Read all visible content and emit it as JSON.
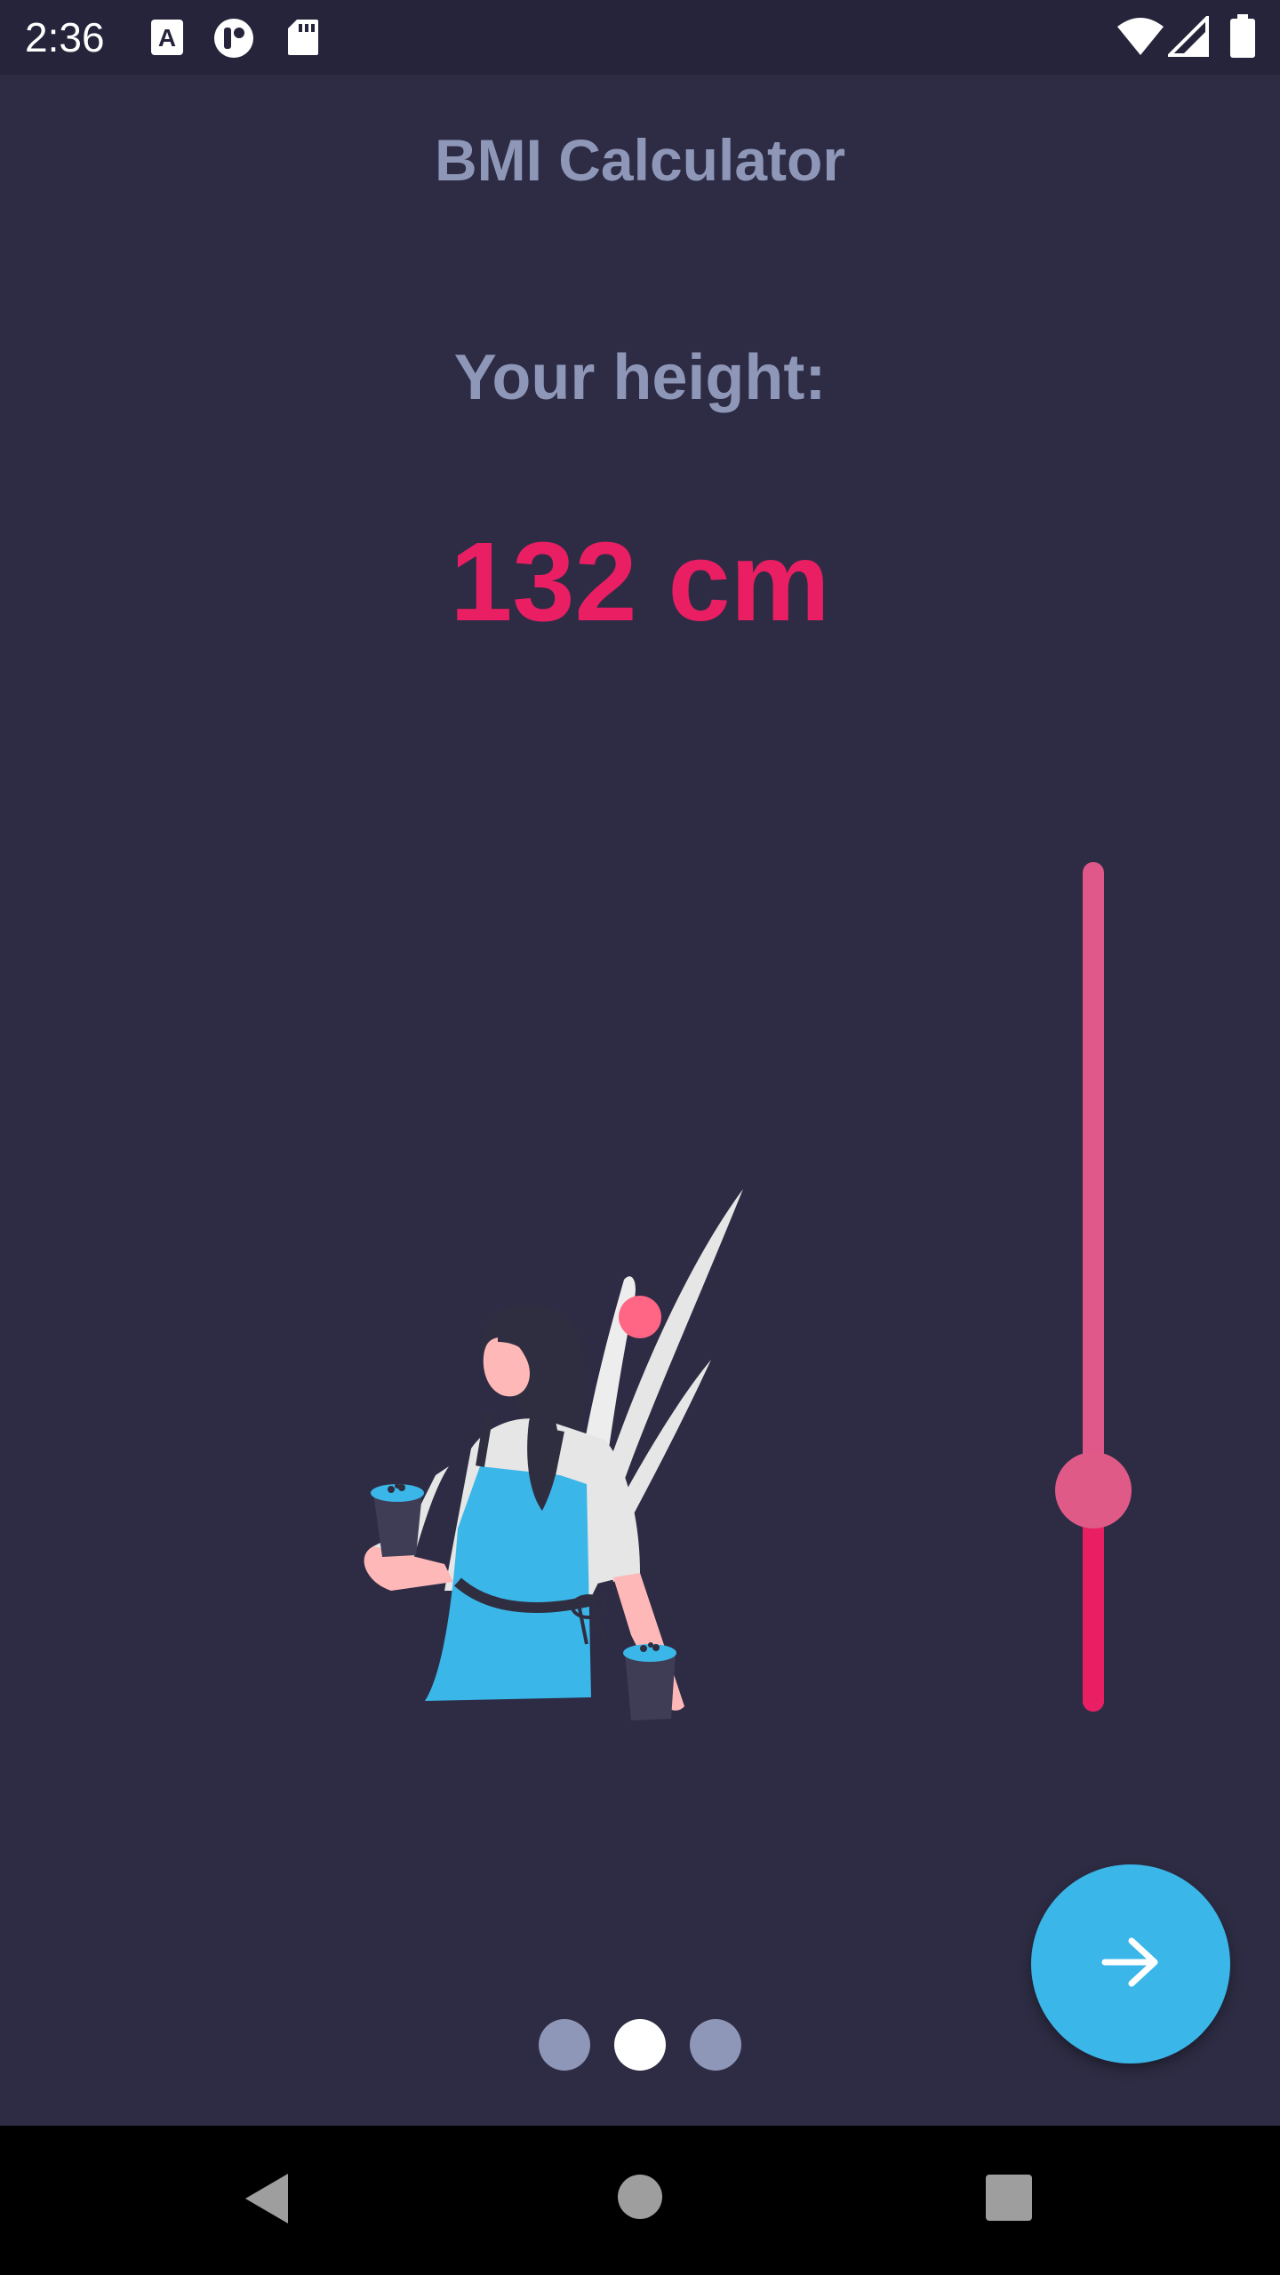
{
  "status_bar": {
    "time": "2:36",
    "icons": [
      "a-notification-icon",
      "circle-app-icon",
      "sd-card-icon",
      "wifi-icon",
      "signal-icon",
      "battery-icon"
    ]
  },
  "app": {
    "title": "BMI Calculator",
    "label": "Your height:",
    "value": "132 cm",
    "slider_value_fraction": 0.26
  },
  "pager": {
    "count": 3,
    "active_index": 1
  },
  "fab": {
    "icon": "arrow-right-icon"
  },
  "nav": {
    "icons": [
      "back-icon",
      "home-icon",
      "recents-icon"
    ]
  },
  "colors": {
    "background": "#2d2c44",
    "accent": "#e91e63",
    "fab": "#3bb6e8",
    "muted_text": "#8f97b8"
  }
}
